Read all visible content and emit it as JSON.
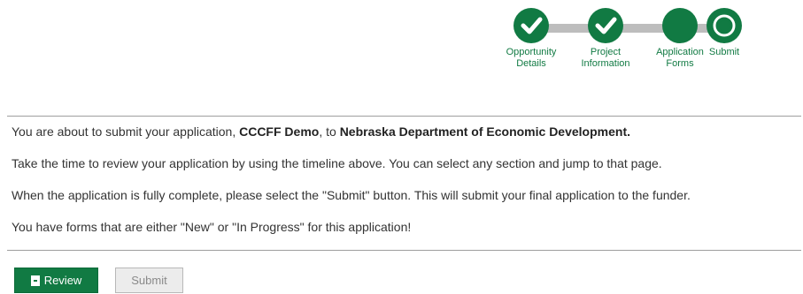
{
  "stepper": {
    "steps": [
      {
        "label_line1": "Opportunity",
        "label_line2": "Details",
        "state": "complete"
      },
      {
        "label_line1": "Project",
        "label_line2": "Information",
        "state": "complete"
      },
      {
        "label_line1": "Application",
        "label_line2": "Forms",
        "state": "current"
      },
      {
        "label_line1": "Submit",
        "label_line2": "",
        "state": "pending"
      }
    ],
    "colors": {
      "accent": "#117a43",
      "track": "#bdbdbd"
    }
  },
  "message": {
    "intro_prefix": "You are about to submit your application, ",
    "application_name": "CCCFF Demo",
    "intro_middle": ", to ",
    "funder_name": "Nebraska Department of Economic Development.",
    "review_instructions": "Take the time to review your application by using the timeline above. You can select any section and jump to that page.",
    "submit_instructions": "When the application is fully complete, please select the \"Submit\" button. This will submit your final application to the funder.",
    "warning": "You have forms that are either \"New\" or \"In Progress\" for this application!",
    "warning_color": "#e8220f"
  },
  "actions": {
    "review_label": "Review",
    "review_icon": "document-icon",
    "submit_label": "Submit"
  }
}
